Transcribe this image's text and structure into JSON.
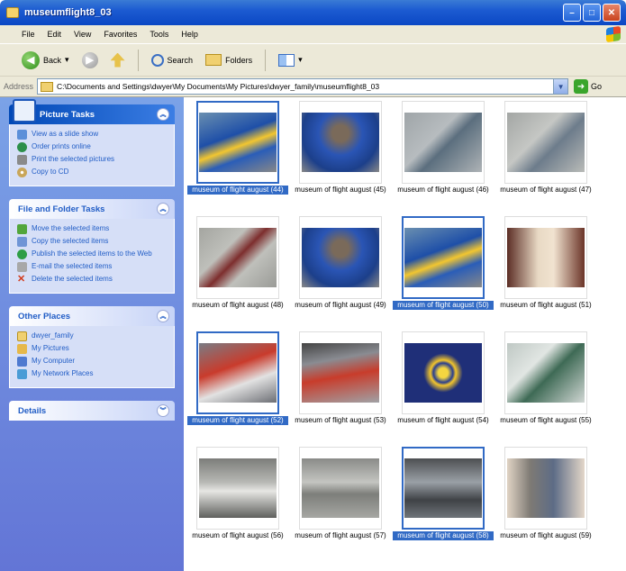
{
  "window": {
    "title": "museumflight8_03"
  },
  "menu": [
    "File",
    "Edit",
    "View",
    "Favorites",
    "Tools",
    "Help"
  ],
  "toolbar": {
    "back_label": "Back",
    "search_label": "Search",
    "folders_label": "Folders"
  },
  "address": {
    "label": "Address",
    "path": "C:\\Documents and Settings\\dwyer\\My Documents\\My Pictures\\dwyer_family\\museumflight8_03",
    "go_label": "Go"
  },
  "panels": {
    "picture_tasks": {
      "title": "Picture Tasks",
      "items": [
        "View as a slide show",
        "Order prints online",
        "Print the selected pictures",
        "Copy to CD"
      ]
    },
    "file_folder_tasks": {
      "title": "File and Folder Tasks",
      "items": [
        "Move the selected items",
        "Copy the selected items",
        "Publish the selected items to the Web",
        "E-mail the selected items",
        "Delete the selected items"
      ]
    },
    "other_places": {
      "title": "Other Places",
      "items": [
        "dwyer_family",
        "My Pictures",
        "My Computer",
        "My Network Places"
      ]
    },
    "details": {
      "title": "Details"
    }
  },
  "thumbnails": [
    {
      "label": "museum of flight august (44)",
      "selected": true,
      "photo": "p-jet-blue"
    },
    {
      "label": "museum of flight august (45)",
      "selected": false,
      "photo": "p-cockpit"
    },
    {
      "label": "museum of flight august (46)",
      "selected": false,
      "photo": "p-wing"
    },
    {
      "label": "museum of flight august (47)",
      "selected": false,
      "photo": "p-tail"
    },
    {
      "label": "museum of flight august (48)",
      "selected": false,
      "photo": "p-redplane"
    },
    {
      "label": "museum of flight august (49)",
      "selected": false,
      "photo": "p-cockpit"
    },
    {
      "label": "museum of flight august (50)",
      "selected": true,
      "photo": "p-jet-blue"
    },
    {
      "label": "museum of flight august (51)",
      "selected": false,
      "photo": "p-interior"
    },
    {
      "label": "museum of flight august (52)",
      "selected": true,
      "photo": "p-redfeet"
    },
    {
      "label": "museum of flight august (53)",
      "selected": false,
      "photo": "p-redfeet2"
    },
    {
      "label": "museum of flight august (54)",
      "selected": false,
      "photo": "p-insignia"
    },
    {
      "label": "museum of flight august (55)",
      "selected": false,
      "photo": "p-greenjet"
    },
    {
      "label": "museum of flight august (56)",
      "selected": false,
      "photo": "p-hangar"
    },
    {
      "label": "museum of flight august (57)",
      "selected": false,
      "photo": "p-hangar2"
    },
    {
      "label": "museum of flight august (58)",
      "selected": true,
      "photo": "p-hangar3"
    },
    {
      "label": "museum of flight august (59)",
      "selected": false,
      "photo": "p-people"
    }
  ]
}
